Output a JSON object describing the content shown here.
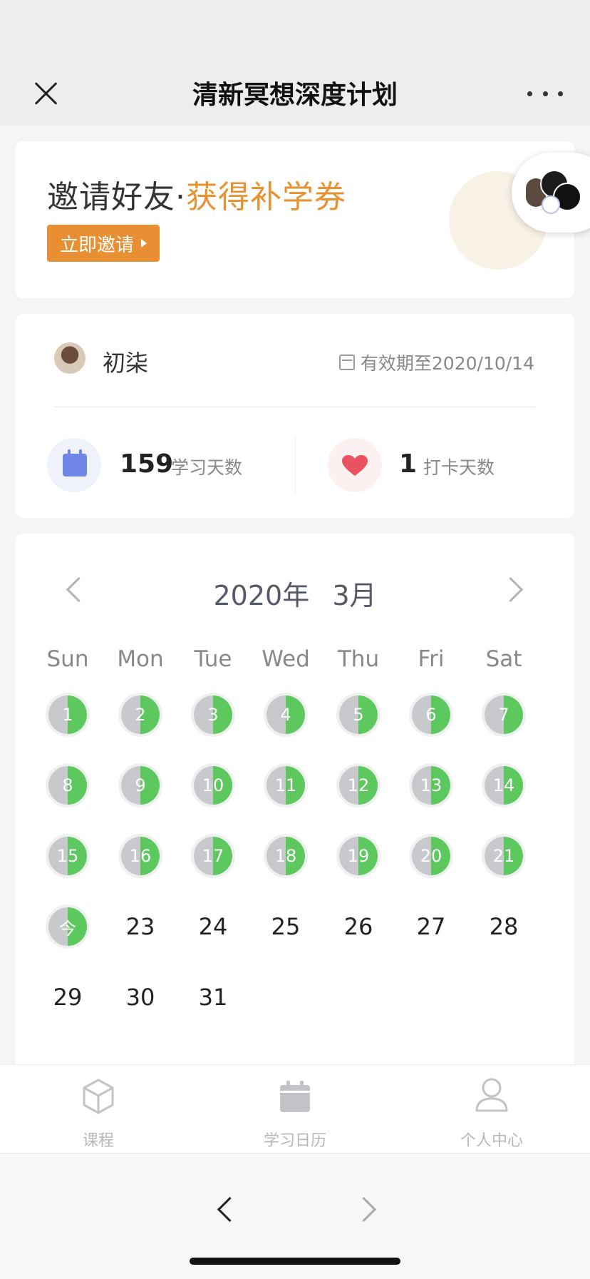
{
  "header": {
    "title": "清新冥想深度计划"
  },
  "invite": {
    "text_main": "邀请好友·",
    "text_highlight": "获得补学券",
    "button_label": "立即邀请"
  },
  "user": {
    "name": "初柒",
    "valid_until": "有效期至2020/10/14",
    "study_days": "159",
    "study_days_label": "学习天数",
    "checkin_days": "1",
    "checkin_days_label": "打卡天数"
  },
  "calendar": {
    "year": "2020年",
    "month": "3月",
    "weekdays": [
      "Sun",
      "Mon",
      "Tue",
      "Wed",
      "Thu",
      "Fri",
      "Sat"
    ],
    "days": [
      {
        "label": "1",
        "done": true
      },
      {
        "label": "2",
        "done": true
      },
      {
        "label": "3",
        "done": true
      },
      {
        "label": "4",
        "done": true
      },
      {
        "label": "5",
        "done": true
      },
      {
        "label": "6",
        "done": true
      },
      {
        "label": "7",
        "done": true
      },
      {
        "label": "8",
        "done": true
      },
      {
        "label": "9",
        "done": true
      },
      {
        "label": "10",
        "done": true
      },
      {
        "label": "11",
        "done": true
      },
      {
        "label": "12",
        "done": true
      },
      {
        "label": "13",
        "done": true
      },
      {
        "label": "14",
        "done": true
      },
      {
        "label": "15",
        "done": true
      },
      {
        "label": "16",
        "done": true
      },
      {
        "label": "17",
        "done": true
      },
      {
        "label": "18",
        "done": true
      },
      {
        "label": "19",
        "done": true
      },
      {
        "label": "20",
        "done": true
      },
      {
        "label": "21",
        "done": true
      },
      {
        "label": "今",
        "done": true
      },
      {
        "label": "23",
        "done": false
      },
      {
        "label": "24",
        "done": false
      },
      {
        "label": "25",
        "done": false
      },
      {
        "label": "26",
        "done": false
      },
      {
        "label": "27",
        "done": false
      },
      {
        "label": "28",
        "done": false
      },
      {
        "label": "29",
        "done": false
      },
      {
        "label": "30",
        "done": false
      },
      {
        "label": "31",
        "done": false
      }
    ]
  },
  "tabs": [
    {
      "label": "课程",
      "icon": "cube-icon"
    },
    {
      "label": "学习日历",
      "icon": "calendar-icon"
    },
    {
      "label": "个人中心",
      "icon": "person-icon"
    }
  ],
  "colors": {
    "accent": "#e98f33",
    "progress": "#5cc85e",
    "pending": "#c8c9cd",
    "calendar_icon": "#6f86e6",
    "heart": "#e9525f"
  }
}
